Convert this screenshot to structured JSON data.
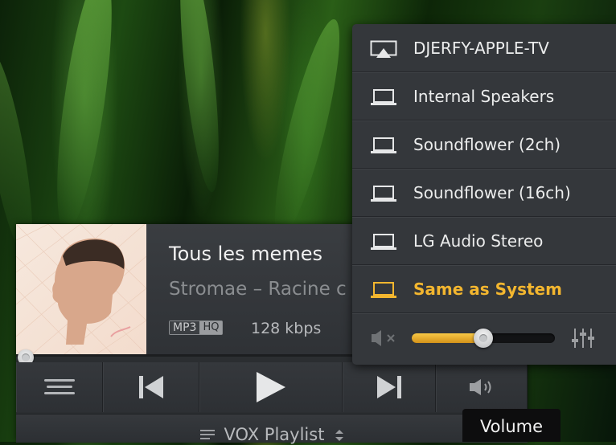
{
  "player": {
    "track_title": "Tous les memes",
    "artist_album": "Stromae – Racine c",
    "format": "MP3",
    "quality": "HQ",
    "bitrate": "128 kbps",
    "progress_fraction": 0.0
  },
  "controls": {
    "menu": "menu-icon",
    "previous": "previous-icon",
    "play": "play-icon",
    "next": "next-icon",
    "volume": "speaker-icon"
  },
  "playlist": {
    "label": "VOX Playlist"
  },
  "output_menu": {
    "items": [
      {
        "label": "DJERFY-APPLE-TV",
        "icon": "airplay-icon",
        "active": false
      },
      {
        "label": "Internal Speakers",
        "icon": "laptop-icon",
        "active": false
      },
      {
        "label": "Soundflower (2ch)",
        "icon": "laptop-icon",
        "active": false
      },
      {
        "label": "Soundflower (16ch)",
        "icon": "laptop-icon",
        "active": false
      },
      {
        "label": "LG Audio Stereo",
        "icon": "laptop-icon",
        "active": false
      },
      {
        "label": "Same as System",
        "icon": "laptop-icon",
        "active": true
      }
    ],
    "volume_fraction": 0.5
  },
  "tooltip": {
    "text": "Volume"
  },
  "colors": {
    "accent": "#f3b62f",
    "panel": "#34373b",
    "text": "#eceded"
  }
}
